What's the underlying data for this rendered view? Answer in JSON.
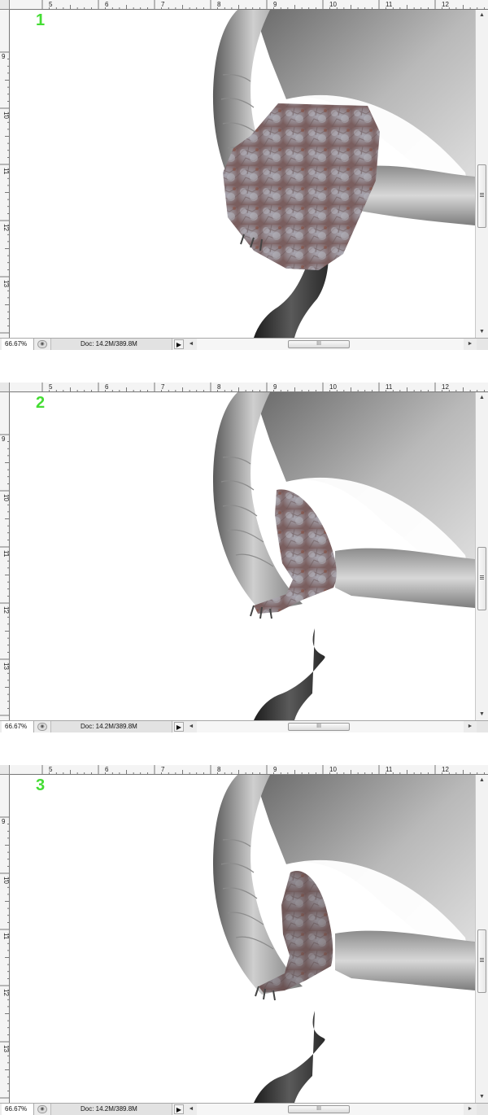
{
  "ruler": {
    "top_labels": [
      "5",
      "6",
      "7",
      "8",
      "9",
      "10",
      "11",
      "12"
    ],
    "left_labels": [
      "9",
      "10",
      "11",
      "12",
      "13"
    ]
  },
  "scroll_arrows": {
    "up": "▲",
    "down": "▼",
    "left": "◄",
    "right": "►",
    "grip": "III"
  },
  "panels": [
    {
      "step": "1",
      "status": {
        "zoom": "66.67%",
        "doc": "Doc: 14.2M/389.8M",
        "menu_arrow": "▶"
      }
    },
    {
      "step": "2",
      "status": {
        "zoom": "66.67%",
        "doc": "Doc: 14.2M/389.8M",
        "menu_arrow": "▶"
      }
    },
    {
      "step": "3",
      "status": {
        "zoom": "66.67%",
        "doc": "Doc: 14.2M/389.8M",
        "menu_arrow": "▶"
      }
    }
  ],
  "colors": {
    "step_number": "#44dd33",
    "dragon_body": "#b8b8b8",
    "texture_overlay": "#8e7f84"
  }
}
